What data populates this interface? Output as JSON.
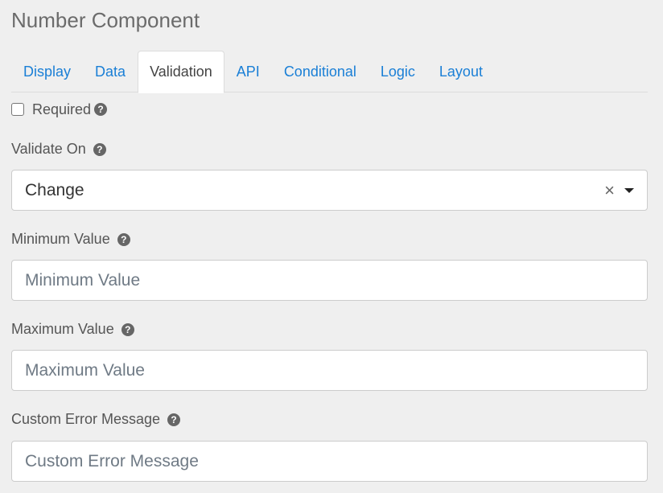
{
  "page": {
    "title": "Number Component"
  },
  "tabs": [
    {
      "label": "Display"
    },
    {
      "label": "Data"
    },
    {
      "label": "Validation"
    },
    {
      "label": "API"
    },
    {
      "label": "Conditional"
    },
    {
      "label": "Logic"
    },
    {
      "label": "Layout"
    }
  ],
  "active_tab": "Validation",
  "required": {
    "label": "Required",
    "checked": false
  },
  "validate_on": {
    "label": "Validate On",
    "value": "Change"
  },
  "minimum": {
    "label": "Minimum Value",
    "placeholder": "Minimum Value"
  },
  "maximum": {
    "label": "Maximum Value",
    "placeholder": "Maximum Value"
  },
  "custom_error": {
    "label": "Custom Error Message",
    "placeholder": "Custom Error Message"
  },
  "icons": {
    "help": "question-circle-icon",
    "clear": "close-icon",
    "dropdown": "caret-down-icon"
  },
  "colors": {
    "link": "#1a7fd6",
    "background": "#efefef"
  }
}
